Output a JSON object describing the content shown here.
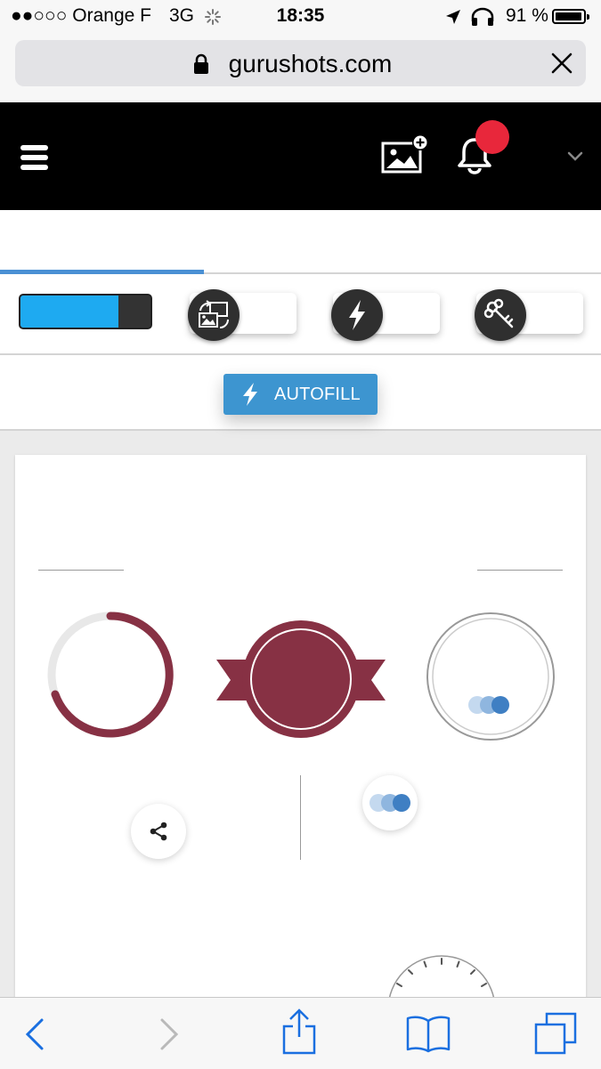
{
  "status_bar": {
    "carrier": "●●○○○ Orange F",
    "network": "3G",
    "time": "18:35",
    "battery": "91 %"
  },
  "browser": {
    "url": "gurushots.com"
  },
  "boost_row": {
    "exposure_level_percent": 75
  },
  "autofill": {
    "label": "AUTOFILL"
  },
  "colors": {
    "header_bg": "#000000",
    "notification_badge": "#e8273b",
    "accent_blue": "#4a90d4",
    "autofill_bg": "#3d95d0",
    "exposure_fill": "#1eaaf1",
    "level_maroon": "#873144"
  },
  "icons": {
    "status": [
      "signal-dots-icon",
      "activity-spinner-icon",
      "location-arrow-icon",
      "headphones-icon",
      "battery-icon"
    ],
    "header": [
      "menu-icon",
      "upload-photo-icon",
      "bell-icon",
      "chevron-down-icon"
    ],
    "boosts": [
      "swap-photo-icon",
      "bolt-icon",
      "key-icon"
    ],
    "card": [
      "share-icon",
      "votes-dots-icon"
    ],
    "safari": [
      "back-icon",
      "forward-icon",
      "share-icon",
      "bookmarks-icon",
      "tabs-icon"
    ]
  }
}
